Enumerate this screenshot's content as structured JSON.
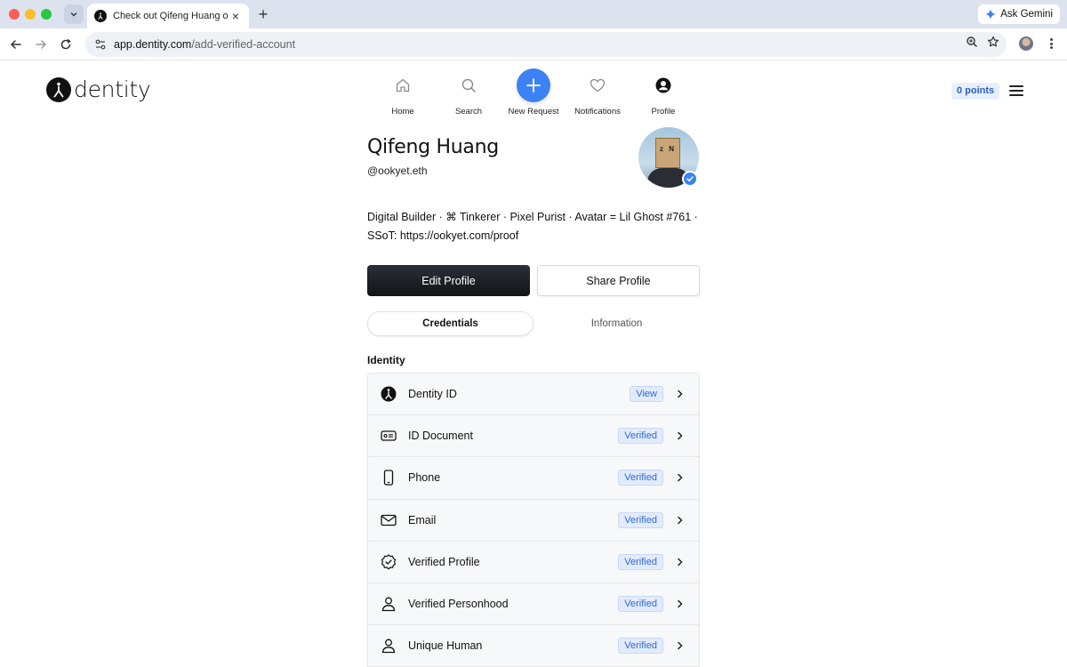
{
  "browser": {
    "tab_title": "Check out Qifeng Huang on Dentity",
    "url_host": "app.dentity.com",
    "url_path": "/add-verified-account",
    "gemini_label": "Ask Gemini"
  },
  "app": {
    "logo_text": "dentity",
    "nav": [
      {
        "label": "Home",
        "icon": "home-icon"
      },
      {
        "label": "Search",
        "icon": "search-icon"
      },
      {
        "label": "New Request",
        "icon": "plus-icon"
      },
      {
        "label": "Notifications",
        "icon": "heart-icon"
      },
      {
        "label": "Profile",
        "icon": "profile-icon"
      }
    ],
    "points_label": "0 points"
  },
  "profile": {
    "name": "Qifeng Huang",
    "handle": "@ookyet.eth",
    "bio": "Digital Builder · ⌘ Tinkerer · Pixel Purist · Avatar = Lil Ghost #761 · SSoT: https://ookyet.com/proof",
    "edit_label": "Edit Profile",
    "share_label": "Share Profile"
  },
  "tabs": {
    "active": "Credentials",
    "inactive": "Information"
  },
  "section_title": "Identity",
  "credentials": [
    {
      "label": "Dentity ID",
      "status": "View",
      "icon": "dentity-logo-icon"
    },
    {
      "label": "ID Document",
      "status": "Verified",
      "icon": "id-card-icon"
    },
    {
      "label": "Phone",
      "status": "Verified",
      "icon": "phone-icon"
    },
    {
      "label": "Email",
      "status": "Verified",
      "icon": "envelope-icon"
    },
    {
      "label": "Verified Profile",
      "status": "Verified",
      "icon": "verified-seal-icon"
    },
    {
      "label": "Verified Personhood",
      "status": "Verified",
      "icon": "person-icon"
    },
    {
      "label": "Unique Human",
      "status": "Verified",
      "icon": "person-icon"
    }
  ],
  "colors": {
    "accent": "#3d82f5",
    "badge_bg": "#e2ebfb",
    "badge_text": "#2f6ad9",
    "primary_button": "#16181d"
  }
}
